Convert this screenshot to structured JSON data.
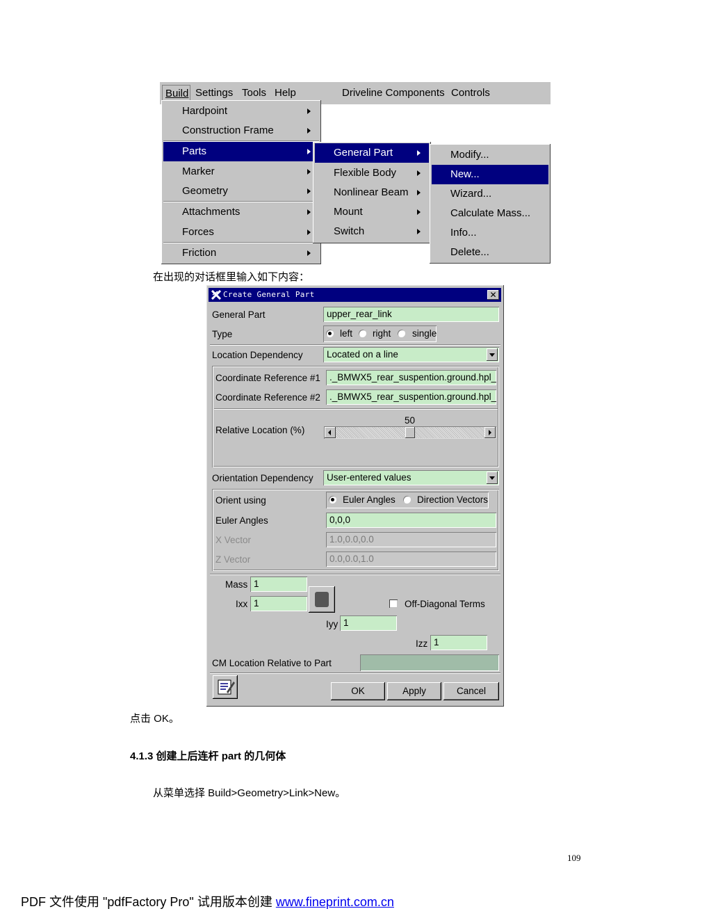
{
  "menubar": {
    "items": [
      "Build",
      "Settings",
      "Tools",
      "Help",
      "Driveline Components",
      "Controls"
    ]
  },
  "build_menu": {
    "items": [
      "Hardpoint",
      "Construction Frame",
      "Parts",
      "Marker",
      "Geometry",
      "Attachments",
      "Forces",
      "Friction"
    ],
    "selected": "Parts"
  },
  "parts_menu": {
    "items": [
      "General Part",
      "Flexible Body",
      "Nonlinear Beam",
      "Mount",
      "Switch"
    ],
    "selected": "General Part"
  },
  "general_part_menu": {
    "items": [
      "Modify...",
      "New...",
      "Wizard...",
      "Calculate Mass...",
      "Info...",
      "Delete..."
    ],
    "selected": "New..."
  },
  "text": {
    "intro": "在出现的对话框里输入如下内容：",
    "click_ok": "点击 OK。",
    "section_heading": "4.1.3 创建上后连杆 part 的几何体",
    "menu_path": "从菜单选择 Build>Geometry>Link>New。",
    "page_number": "109",
    "footer_prefix": "PDF 文件使用 \"pdfFactory Pro\" 试用版本创建 ",
    "footer_link": "www.fineprint.com.cn"
  },
  "dialog": {
    "title": "Create General Part",
    "close_label": "✕",
    "general_part": {
      "label": "General Part",
      "value": "upper_rear_link"
    },
    "type": {
      "label": "Type",
      "options": [
        "left",
        "right",
        "single"
      ],
      "selected": "left"
    },
    "location_dependency": {
      "label": "Location Dependency",
      "value": "Located on a line"
    },
    "coord_ref_1": {
      "label": "Coordinate Reference #1",
      "value": "._BMWX5_rear_suspention.ground.hpl_"
    },
    "coord_ref_2": {
      "label": "Coordinate Reference #2",
      "value": "._BMWX5_rear_suspention.ground.hpl_"
    },
    "relative_location": {
      "label": "Relative Location (%)",
      "value": 50,
      "value_text": "50",
      "min": 0,
      "max": 100
    },
    "orientation_dependency": {
      "label": "Orientation Dependency",
      "value": "User-entered values"
    },
    "orient_using": {
      "label": "Orient using",
      "options": [
        "Euler Angles",
        "Direction Vectors"
      ],
      "selected": "Euler Angles"
    },
    "euler_angles": {
      "label": "Euler Angles",
      "value": "0,0,0"
    },
    "x_vector": {
      "label": "X Vector",
      "value": "1.0,0.0,0.0"
    },
    "z_vector": {
      "label": "Z Vector",
      "value": "0.0,0.0,1.0"
    },
    "mass": {
      "label": "Mass",
      "value": "1"
    },
    "ixx": {
      "label": "Ixx",
      "value": "1"
    },
    "iyy": {
      "label": "Iyy",
      "value": "1"
    },
    "izz": {
      "label": "Izz",
      "value": "1"
    },
    "off_diagonal": {
      "label": "Off-Diagonal Terms",
      "checked": false
    },
    "cm_location": {
      "label": "CM Location Relative to Part",
      "value": ""
    },
    "buttons": {
      "ok": "OK",
      "apply": "Apply",
      "cancel": "Cancel"
    }
  },
  "colors": {
    "menu_gray": "#c4c4c4",
    "highlight_navy": "#00007f",
    "field_green": "#c8ecc8",
    "link_blue": "#0000ee"
  }
}
